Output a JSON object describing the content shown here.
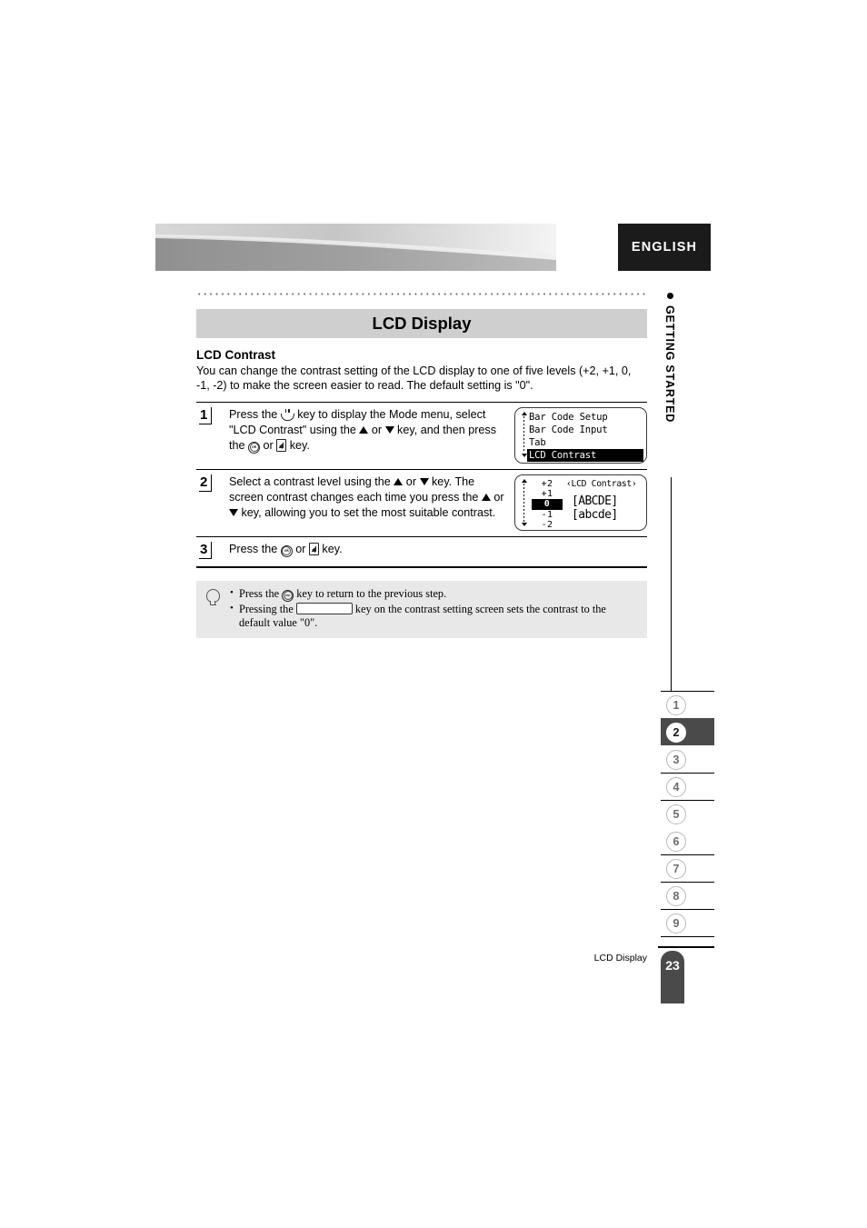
{
  "header": {
    "language_label": "ENGLISH",
    "banner_icon": "gradient-swoosh-banner"
  },
  "side_chapter": {
    "bullet_icon": "bullet-dot",
    "text": "GETTING STARTED"
  },
  "section": {
    "title": "LCD Display",
    "subsection_title": "LCD Contrast",
    "intro": "You can change the contrast setting of the LCD display to one of five levels (+2, +1, 0, -1, -2) to make the screen easier to read. The default setting is \"0\"."
  },
  "steps": [
    {
      "number": "1",
      "text_parts": {
        "p1": "Press the ",
        "key1_icon": "menu-key-icon",
        "p2": " key to display the Mode menu, select \"LCD Contrast\" using the ",
        "key2_icon": "arrow-up-icon",
        "p3": " or ",
        "key3_icon": "arrow-down-icon",
        "p4": " key, and then press the ",
        "key4_icon": "ok-key-icon",
        "p5": " or ",
        "key5_icon": "enter-key-icon",
        "p6": " key."
      }
    },
    {
      "number": "2",
      "text_parts": {
        "p1": "Select a contrast level using the ",
        "key1_icon": "arrow-up-icon",
        "p2": " or ",
        "key2_icon": "arrow-down-icon",
        "p3": " key. The screen contrast changes each time you press the ",
        "key3_icon": "arrow-up-icon",
        "p4": " or ",
        "key4_icon": "arrow-down-icon",
        "p5": " key, allowing you to set the most suitable contrast."
      }
    },
    {
      "number": "3",
      "text_parts": {
        "p1": "Press the ",
        "key1_icon": "ok-key-icon",
        "p2": " or ",
        "key2_icon": "enter-key-icon",
        "p3": " key."
      }
    }
  ],
  "lcd_menu_screen": {
    "scroll_up_icon": "scroll-up-arrow",
    "scroll_down_icon": "scroll-down-arrow",
    "rows": [
      {
        "label": "Bar Code Setup",
        "selected": false
      },
      {
        "label": "Bar Code Input",
        "selected": false
      },
      {
        "label": "Tab",
        "selected": false
      },
      {
        "label": "LCD Contrast",
        "selected": true
      }
    ]
  },
  "lcd_contrast_screen": {
    "title": "‹LCD Contrast›",
    "sample_upper": "[ABCDE]",
    "sample_lower": "[abcde]",
    "levels": [
      {
        "label": "+2",
        "selected": false
      },
      {
        "label": "+1",
        "selected": false
      },
      {
        "label": "0",
        "selected": true
      },
      {
        "label": "-1",
        "selected": false
      },
      {
        "label": "-2",
        "selected": false
      }
    ]
  },
  "tip_box": {
    "icon": "lightbulb-icon",
    "items": [
      {
        "p1": "Press the ",
        "key_icon": "esc-key-icon",
        "p2": " key to return to the previous step."
      },
      {
        "p1": "Pressing the ",
        "key_icon": "space-bar-key-icon",
        "p2": " key on the contrast setting screen sets the contrast to the default value \"0\"."
      }
    ]
  },
  "right_nav": {
    "tabs": [
      {
        "label": "1",
        "active": false
      },
      {
        "label": "2",
        "active": true
      },
      {
        "label": "3",
        "active": false
      },
      {
        "label": "4",
        "active": false
      },
      {
        "label": "5",
        "active": false
      },
      {
        "label": "6",
        "active": false
      },
      {
        "label": "7",
        "active": false
      },
      {
        "label": "8",
        "active": false
      },
      {
        "label": "9",
        "active": false
      }
    ]
  },
  "footer": {
    "caption": "LCD Display",
    "page_number": "23"
  }
}
